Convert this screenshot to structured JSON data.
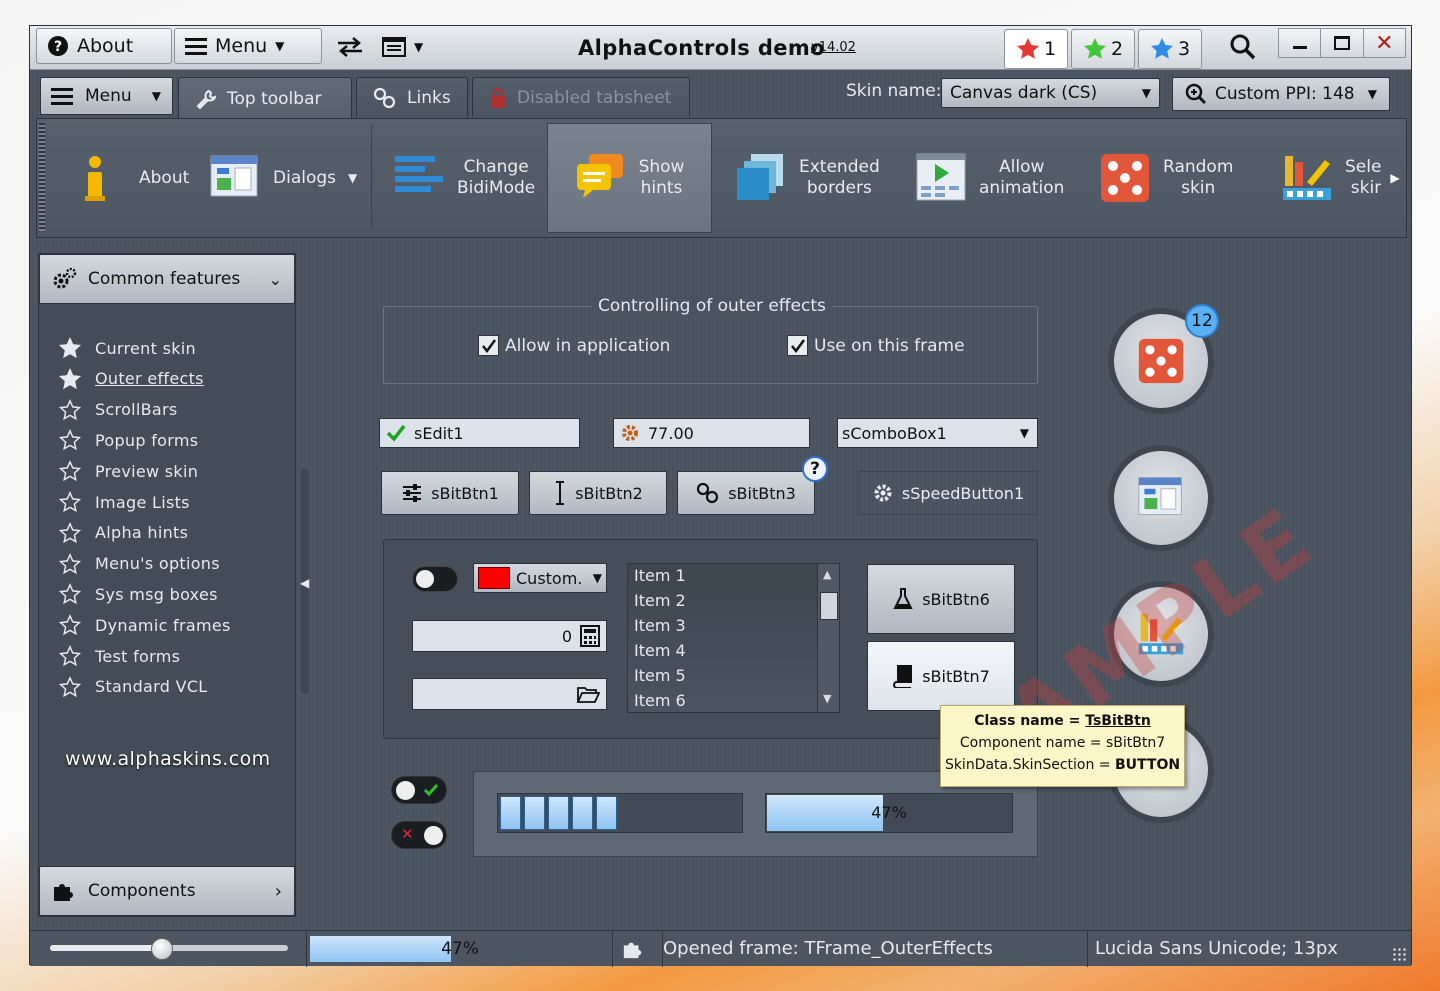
{
  "window": {
    "title": "AlphaControls demo",
    "version": "v14.02"
  },
  "titlebar": {
    "about_label": "About",
    "menu_label": "Menu",
    "star_tabs": [
      {
        "label": "1",
        "color": "#e53935"
      },
      {
        "label": "2",
        "color": "#43c63a"
      },
      {
        "label": "3",
        "color": "#2f8ae8"
      }
    ]
  },
  "tabs": {
    "menu_label": "Menu",
    "items": [
      "Top toolbar",
      "Links",
      "Disabled tabsheet"
    ]
  },
  "skin": {
    "label": "Skin name:",
    "value": "Canvas dark (CS)",
    "ppi_label": "Custom PPI: 148"
  },
  "ribbon": {
    "about": "About",
    "dialogs": "Dialogs",
    "change_bidi": [
      "Change",
      "BidiMode"
    ],
    "show_hints": [
      "Show",
      "hints"
    ],
    "extended_borders": [
      "Extended",
      "borders"
    ],
    "allow_animation": [
      "Allow",
      "animation"
    ],
    "random_skin": [
      "Random",
      "skin"
    ],
    "select_skin": [
      "Selec",
      "skin"
    ]
  },
  "sidebar": {
    "header": "Common features",
    "items": [
      {
        "label": "Current skin",
        "filled": true
      },
      {
        "label": "Outer effects",
        "filled": true
      },
      {
        "label": "ScrollBars",
        "filled": false
      },
      {
        "label": "Popup forms",
        "filled": false
      },
      {
        "label": "Preview skin",
        "filled": false
      },
      {
        "label": "Image Lists",
        "filled": false
      },
      {
        "label": "Alpha hints",
        "filled": false
      },
      {
        "label": "Menu's options",
        "filled": false
      },
      {
        "label": "Sys msg boxes",
        "filled": false
      },
      {
        "label": "Dynamic frames",
        "filled": false
      },
      {
        "label": "Test forms",
        "filled": false
      },
      {
        "label": "Standard VCL",
        "filled": false
      }
    ],
    "website": "www.alphaskins.com",
    "footer": "Components"
  },
  "main": {
    "group_title": "Controlling of outer effects",
    "allow_in_app": "Allow in application",
    "use_on_frame": "Use on this frame",
    "edit1": "sEdit1",
    "spin_value": "77.00",
    "combo": "sComboBox1",
    "bitbtn1": "sBitBtn1",
    "bitbtn2": "sBitBtn2",
    "bitbtn3": "sBitBtn3",
    "speedbtn": "sSpeedButton1",
    "color_label": "Custom.",
    "calc_value": "0",
    "list_items": [
      "Item 1",
      "Item 2",
      "Item 3",
      "Item 4",
      "Item 5",
      "Item 6"
    ],
    "bitbtn6": "sBitBtn6",
    "bitbtn7": "sBitBtn7",
    "badge": "12",
    "hint_mark": "?",
    "progress_percent": "47%",
    "progress_value": 0.47,
    "watermark": "SAMPLE"
  },
  "tooltip": {
    "line1_key": "Class name = ",
    "line1_val": "TsBitBtn",
    "line2": "Component name = sBitBtn7",
    "line3_key": "SkinData.SkinSection = ",
    "line3_val": "BUTTON"
  },
  "statusbar": {
    "progress_percent": "47%",
    "message": "Opened frame: TFrame_OuterEffects",
    "font": "Lucida Sans Unicode; 13px"
  }
}
